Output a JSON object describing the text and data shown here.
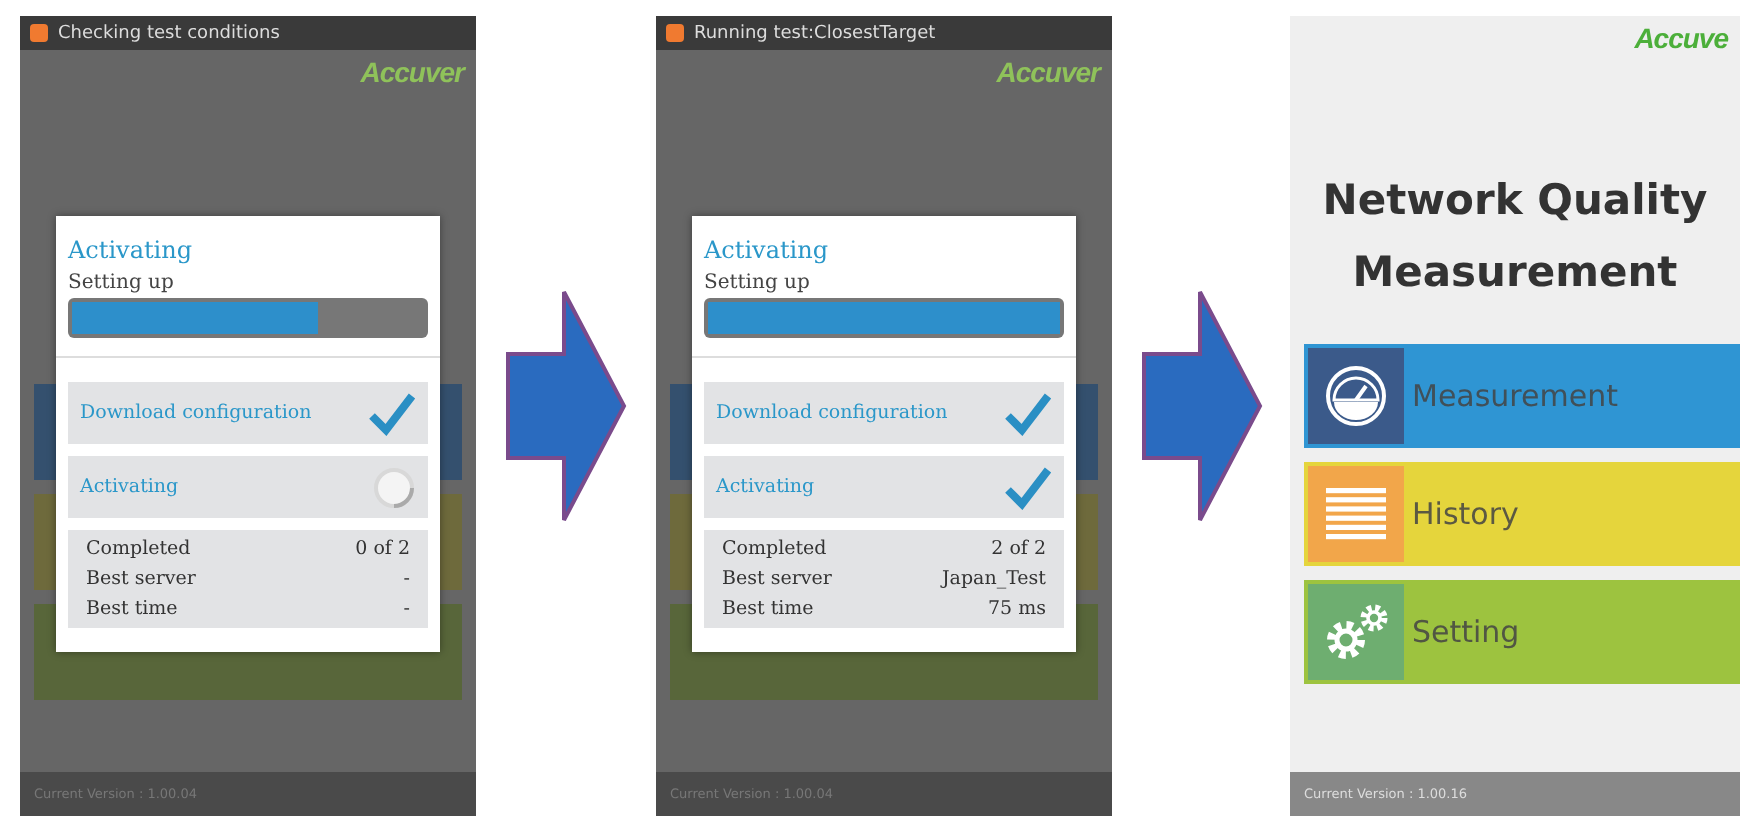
{
  "screens": [
    {
      "kind": "dialog",
      "status_bar": {
        "title": "Checking test conditions"
      },
      "logo": "Accuver",
      "dialog": {
        "title": "Activating",
        "subtitle": "Setting up",
        "progress": {
          "level": 0.7
        },
        "steps": [
          {
            "label": "Download configuration",
            "done": true
          },
          {
            "label": "Activating",
            "done": false
          }
        ],
        "stats": [
          {
            "label": "Completed",
            "value": "0 of 2"
          },
          {
            "label": "Best server",
            "value": "-"
          },
          {
            "label": "Best time",
            "value": "-"
          }
        ]
      },
      "version": "Current Version : 1.00.04"
    },
    {
      "kind": "dialog",
      "status_bar": {
        "title": "Running test:ClosestTarget"
      },
      "logo": "Accuver",
      "dialog": {
        "title": "Activating",
        "subtitle": "Setting up",
        "progress": {
          "level": 1
        },
        "steps": [
          {
            "label": "Download configuration",
            "done": true
          },
          {
            "label": "Activating",
            "done": true
          }
        ],
        "stats": [
          {
            "label": "Completed",
            "value": "2 of 2"
          },
          {
            "label": "Best server",
            "value": "Japan_Test"
          },
          {
            "label": "Best time",
            "value": "75 ms"
          }
        ]
      },
      "version": "Current Version : 1.00.04"
    },
    {
      "kind": "home",
      "logo": "Accuve",
      "title": "Network Quality Measurement",
      "menu": [
        {
          "kind": "gauge",
          "label": "Measurement",
          "color": "#2f95d3"
        },
        {
          "kind": "list",
          "label": "History",
          "color": "#e5d53c"
        },
        {
          "kind": "gears",
          "label": "Setting",
          "color": "#9dc33f"
        }
      ],
      "version": "Current Version : 1.00.16"
    }
  ]
}
